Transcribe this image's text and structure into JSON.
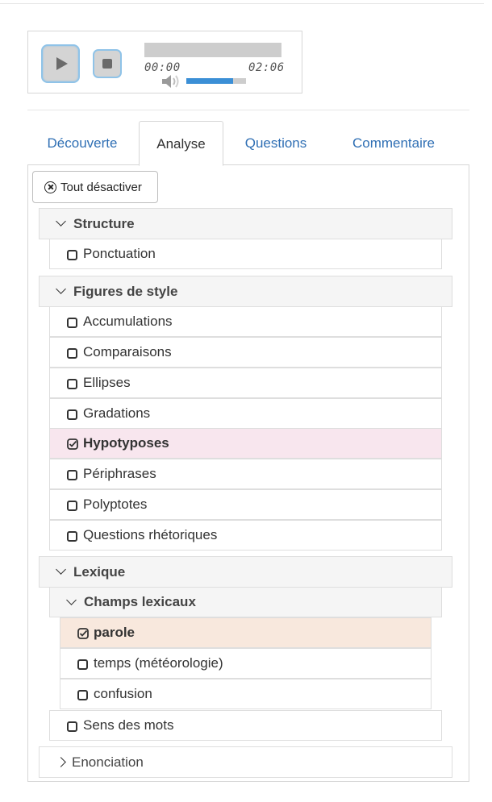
{
  "player": {
    "current_time": "00:00",
    "duration": "02:06",
    "volume_level": 0.78,
    "accent_color": "#3b8fd6"
  },
  "tabs": [
    {
      "label": "Découverte",
      "active": false
    },
    {
      "label": "Analyse",
      "active": true
    },
    {
      "label": "Questions",
      "active": false
    },
    {
      "label": "Commentaire",
      "active": false
    }
  ],
  "reset_button": {
    "label": "Tout désactiver",
    "icon": "circle-x-icon"
  },
  "sections": {
    "structure": {
      "title": "Structure",
      "items": [
        {
          "label": "Ponctuation",
          "checked": false
        }
      ]
    },
    "figures": {
      "title": "Figures de style",
      "items": [
        {
          "label": "Accumulations",
          "checked": false
        },
        {
          "label": "Comparaisons",
          "checked": false
        },
        {
          "label": "Ellipses",
          "checked": false
        },
        {
          "label": "Gradations",
          "checked": false
        },
        {
          "label": "Hypotyposes",
          "checked": true,
          "highlight": "#f8e6ee"
        },
        {
          "label": "Périphrases",
          "checked": false
        },
        {
          "label": "Polyptotes",
          "checked": false
        },
        {
          "label": "Questions rhétoriques",
          "checked": false
        }
      ]
    },
    "lexique": {
      "title": "Lexique",
      "champs": {
        "title": "Champs lexicaux",
        "items": [
          {
            "label": "parole",
            "checked": true,
            "highlight": "#f8e8dd"
          },
          {
            "label": "temps (météorologie)",
            "checked": false
          },
          {
            "label": "confusion",
            "checked": false
          }
        ]
      },
      "sens": {
        "label": "Sens des mots",
        "checked": false
      }
    },
    "enonciation": {
      "title": "Enonciation"
    }
  }
}
